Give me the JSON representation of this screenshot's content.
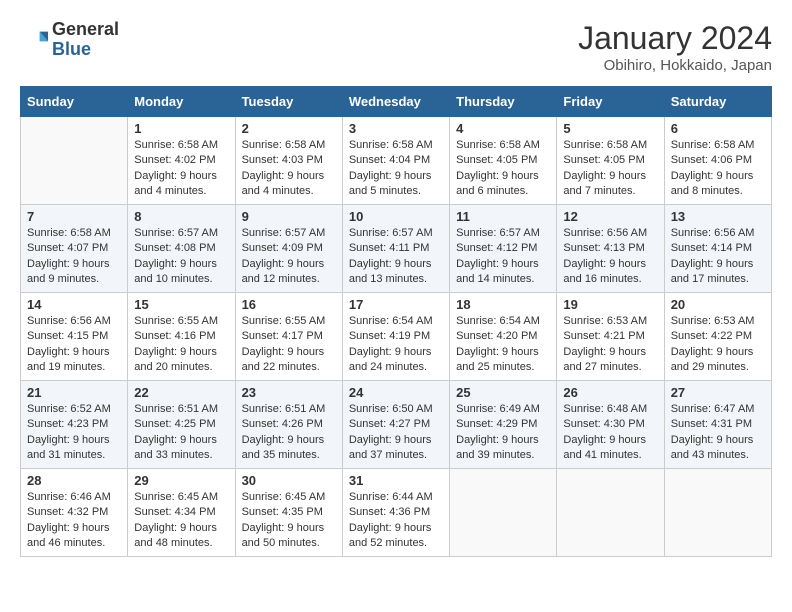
{
  "header": {
    "logo_general": "General",
    "logo_blue": "Blue",
    "title": "January 2024",
    "subtitle": "Obihiro, Hokkaido, Japan"
  },
  "weekdays": [
    "Sunday",
    "Monday",
    "Tuesday",
    "Wednesday",
    "Thursday",
    "Friday",
    "Saturday"
  ],
  "weeks": [
    [
      {
        "day": "",
        "sunrise": "",
        "sunset": "",
        "daylight": ""
      },
      {
        "day": "1",
        "sunrise": "Sunrise: 6:58 AM",
        "sunset": "Sunset: 4:02 PM",
        "daylight": "Daylight: 9 hours and 4 minutes."
      },
      {
        "day": "2",
        "sunrise": "Sunrise: 6:58 AM",
        "sunset": "Sunset: 4:03 PM",
        "daylight": "Daylight: 9 hours and 4 minutes."
      },
      {
        "day": "3",
        "sunrise": "Sunrise: 6:58 AM",
        "sunset": "Sunset: 4:04 PM",
        "daylight": "Daylight: 9 hours and 5 minutes."
      },
      {
        "day": "4",
        "sunrise": "Sunrise: 6:58 AM",
        "sunset": "Sunset: 4:05 PM",
        "daylight": "Daylight: 9 hours and 6 minutes."
      },
      {
        "day": "5",
        "sunrise": "Sunrise: 6:58 AM",
        "sunset": "Sunset: 4:05 PM",
        "daylight": "Daylight: 9 hours and 7 minutes."
      },
      {
        "day": "6",
        "sunrise": "Sunrise: 6:58 AM",
        "sunset": "Sunset: 4:06 PM",
        "daylight": "Daylight: 9 hours and 8 minutes."
      }
    ],
    [
      {
        "day": "7",
        "sunrise": "Sunrise: 6:58 AM",
        "sunset": "Sunset: 4:07 PM",
        "daylight": "Daylight: 9 hours and 9 minutes."
      },
      {
        "day": "8",
        "sunrise": "Sunrise: 6:57 AM",
        "sunset": "Sunset: 4:08 PM",
        "daylight": "Daylight: 9 hours and 10 minutes."
      },
      {
        "day": "9",
        "sunrise": "Sunrise: 6:57 AM",
        "sunset": "Sunset: 4:09 PM",
        "daylight": "Daylight: 9 hours and 12 minutes."
      },
      {
        "day": "10",
        "sunrise": "Sunrise: 6:57 AM",
        "sunset": "Sunset: 4:11 PM",
        "daylight": "Daylight: 9 hours and 13 minutes."
      },
      {
        "day": "11",
        "sunrise": "Sunrise: 6:57 AM",
        "sunset": "Sunset: 4:12 PM",
        "daylight": "Daylight: 9 hours and 14 minutes."
      },
      {
        "day": "12",
        "sunrise": "Sunrise: 6:56 AM",
        "sunset": "Sunset: 4:13 PM",
        "daylight": "Daylight: 9 hours and 16 minutes."
      },
      {
        "day": "13",
        "sunrise": "Sunrise: 6:56 AM",
        "sunset": "Sunset: 4:14 PM",
        "daylight": "Daylight: 9 hours and 17 minutes."
      }
    ],
    [
      {
        "day": "14",
        "sunrise": "Sunrise: 6:56 AM",
        "sunset": "Sunset: 4:15 PM",
        "daylight": "Daylight: 9 hours and 19 minutes."
      },
      {
        "day": "15",
        "sunrise": "Sunrise: 6:55 AM",
        "sunset": "Sunset: 4:16 PM",
        "daylight": "Daylight: 9 hours and 20 minutes."
      },
      {
        "day": "16",
        "sunrise": "Sunrise: 6:55 AM",
        "sunset": "Sunset: 4:17 PM",
        "daylight": "Daylight: 9 hours and 22 minutes."
      },
      {
        "day": "17",
        "sunrise": "Sunrise: 6:54 AM",
        "sunset": "Sunset: 4:19 PM",
        "daylight": "Daylight: 9 hours and 24 minutes."
      },
      {
        "day": "18",
        "sunrise": "Sunrise: 6:54 AM",
        "sunset": "Sunset: 4:20 PM",
        "daylight": "Daylight: 9 hours and 25 minutes."
      },
      {
        "day": "19",
        "sunrise": "Sunrise: 6:53 AM",
        "sunset": "Sunset: 4:21 PM",
        "daylight": "Daylight: 9 hours and 27 minutes."
      },
      {
        "day": "20",
        "sunrise": "Sunrise: 6:53 AM",
        "sunset": "Sunset: 4:22 PM",
        "daylight": "Daylight: 9 hours and 29 minutes."
      }
    ],
    [
      {
        "day": "21",
        "sunrise": "Sunrise: 6:52 AM",
        "sunset": "Sunset: 4:23 PM",
        "daylight": "Daylight: 9 hours and 31 minutes."
      },
      {
        "day": "22",
        "sunrise": "Sunrise: 6:51 AM",
        "sunset": "Sunset: 4:25 PM",
        "daylight": "Daylight: 9 hours and 33 minutes."
      },
      {
        "day": "23",
        "sunrise": "Sunrise: 6:51 AM",
        "sunset": "Sunset: 4:26 PM",
        "daylight": "Daylight: 9 hours and 35 minutes."
      },
      {
        "day": "24",
        "sunrise": "Sunrise: 6:50 AM",
        "sunset": "Sunset: 4:27 PM",
        "daylight": "Daylight: 9 hours and 37 minutes."
      },
      {
        "day": "25",
        "sunrise": "Sunrise: 6:49 AM",
        "sunset": "Sunset: 4:29 PM",
        "daylight": "Daylight: 9 hours and 39 minutes."
      },
      {
        "day": "26",
        "sunrise": "Sunrise: 6:48 AM",
        "sunset": "Sunset: 4:30 PM",
        "daylight": "Daylight: 9 hours and 41 minutes."
      },
      {
        "day": "27",
        "sunrise": "Sunrise: 6:47 AM",
        "sunset": "Sunset: 4:31 PM",
        "daylight": "Daylight: 9 hours and 43 minutes."
      }
    ],
    [
      {
        "day": "28",
        "sunrise": "Sunrise: 6:46 AM",
        "sunset": "Sunset: 4:32 PM",
        "daylight": "Daylight: 9 hours and 46 minutes."
      },
      {
        "day": "29",
        "sunrise": "Sunrise: 6:45 AM",
        "sunset": "Sunset: 4:34 PM",
        "daylight": "Daylight: 9 hours and 48 minutes."
      },
      {
        "day": "30",
        "sunrise": "Sunrise: 6:45 AM",
        "sunset": "Sunset: 4:35 PM",
        "daylight": "Daylight: 9 hours and 50 minutes."
      },
      {
        "day": "31",
        "sunrise": "Sunrise: 6:44 AM",
        "sunset": "Sunset: 4:36 PM",
        "daylight": "Daylight: 9 hours and 52 minutes."
      },
      {
        "day": "",
        "sunrise": "",
        "sunset": "",
        "daylight": ""
      },
      {
        "day": "",
        "sunrise": "",
        "sunset": "",
        "daylight": ""
      },
      {
        "day": "",
        "sunrise": "",
        "sunset": "",
        "daylight": ""
      }
    ]
  ]
}
